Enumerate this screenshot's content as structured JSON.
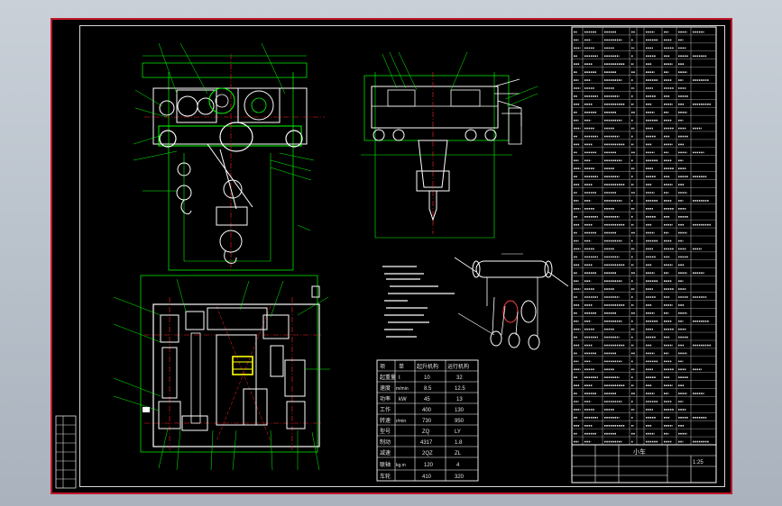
{
  "colors": {
    "background": "#000000",
    "frame": "#c0182a",
    "linework": "#00ff00",
    "outline": "#ffffff",
    "centerline": "#ff2020",
    "dimension": "#ffffff",
    "highlight": "#ffff00",
    "accent_blue": "#3060ff",
    "accent_cyan": "#00e0e0",
    "accent_magenta": "#ff40ff"
  },
  "icons": {
    "hook": "hook-icon",
    "gear": "gear-icon",
    "drum": "drum-icon",
    "wheel": "wheel-icon"
  },
  "spec_table": {
    "header": [
      "项",
      "单",
      "起升机构",
      "运行机构"
    ],
    "rows": [
      [
        "起重量",
        "t",
        "10",
        "32"
      ],
      [
        "速度",
        "m/min",
        "8.5",
        "12.5"
      ],
      [
        "功率",
        "kW",
        "45",
        "13"
      ],
      [
        "工作",
        "",
        "400",
        "130"
      ],
      [
        "转速",
        "r/min",
        "730",
        "950"
      ],
      [
        "型号",
        "",
        "ZQ",
        "LY"
      ],
      [
        "制动",
        "",
        "4317",
        "1.8"
      ],
      [
        "减速",
        "",
        "2QZ",
        "ZL"
      ],
      [
        "联轴",
        "kg.m",
        "120",
        "4"
      ],
      [
        "车轮",
        "",
        "410",
        "320"
      ]
    ]
  },
  "title_block": {
    "name": "小车",
    "scale": "1:25"
  }
}
